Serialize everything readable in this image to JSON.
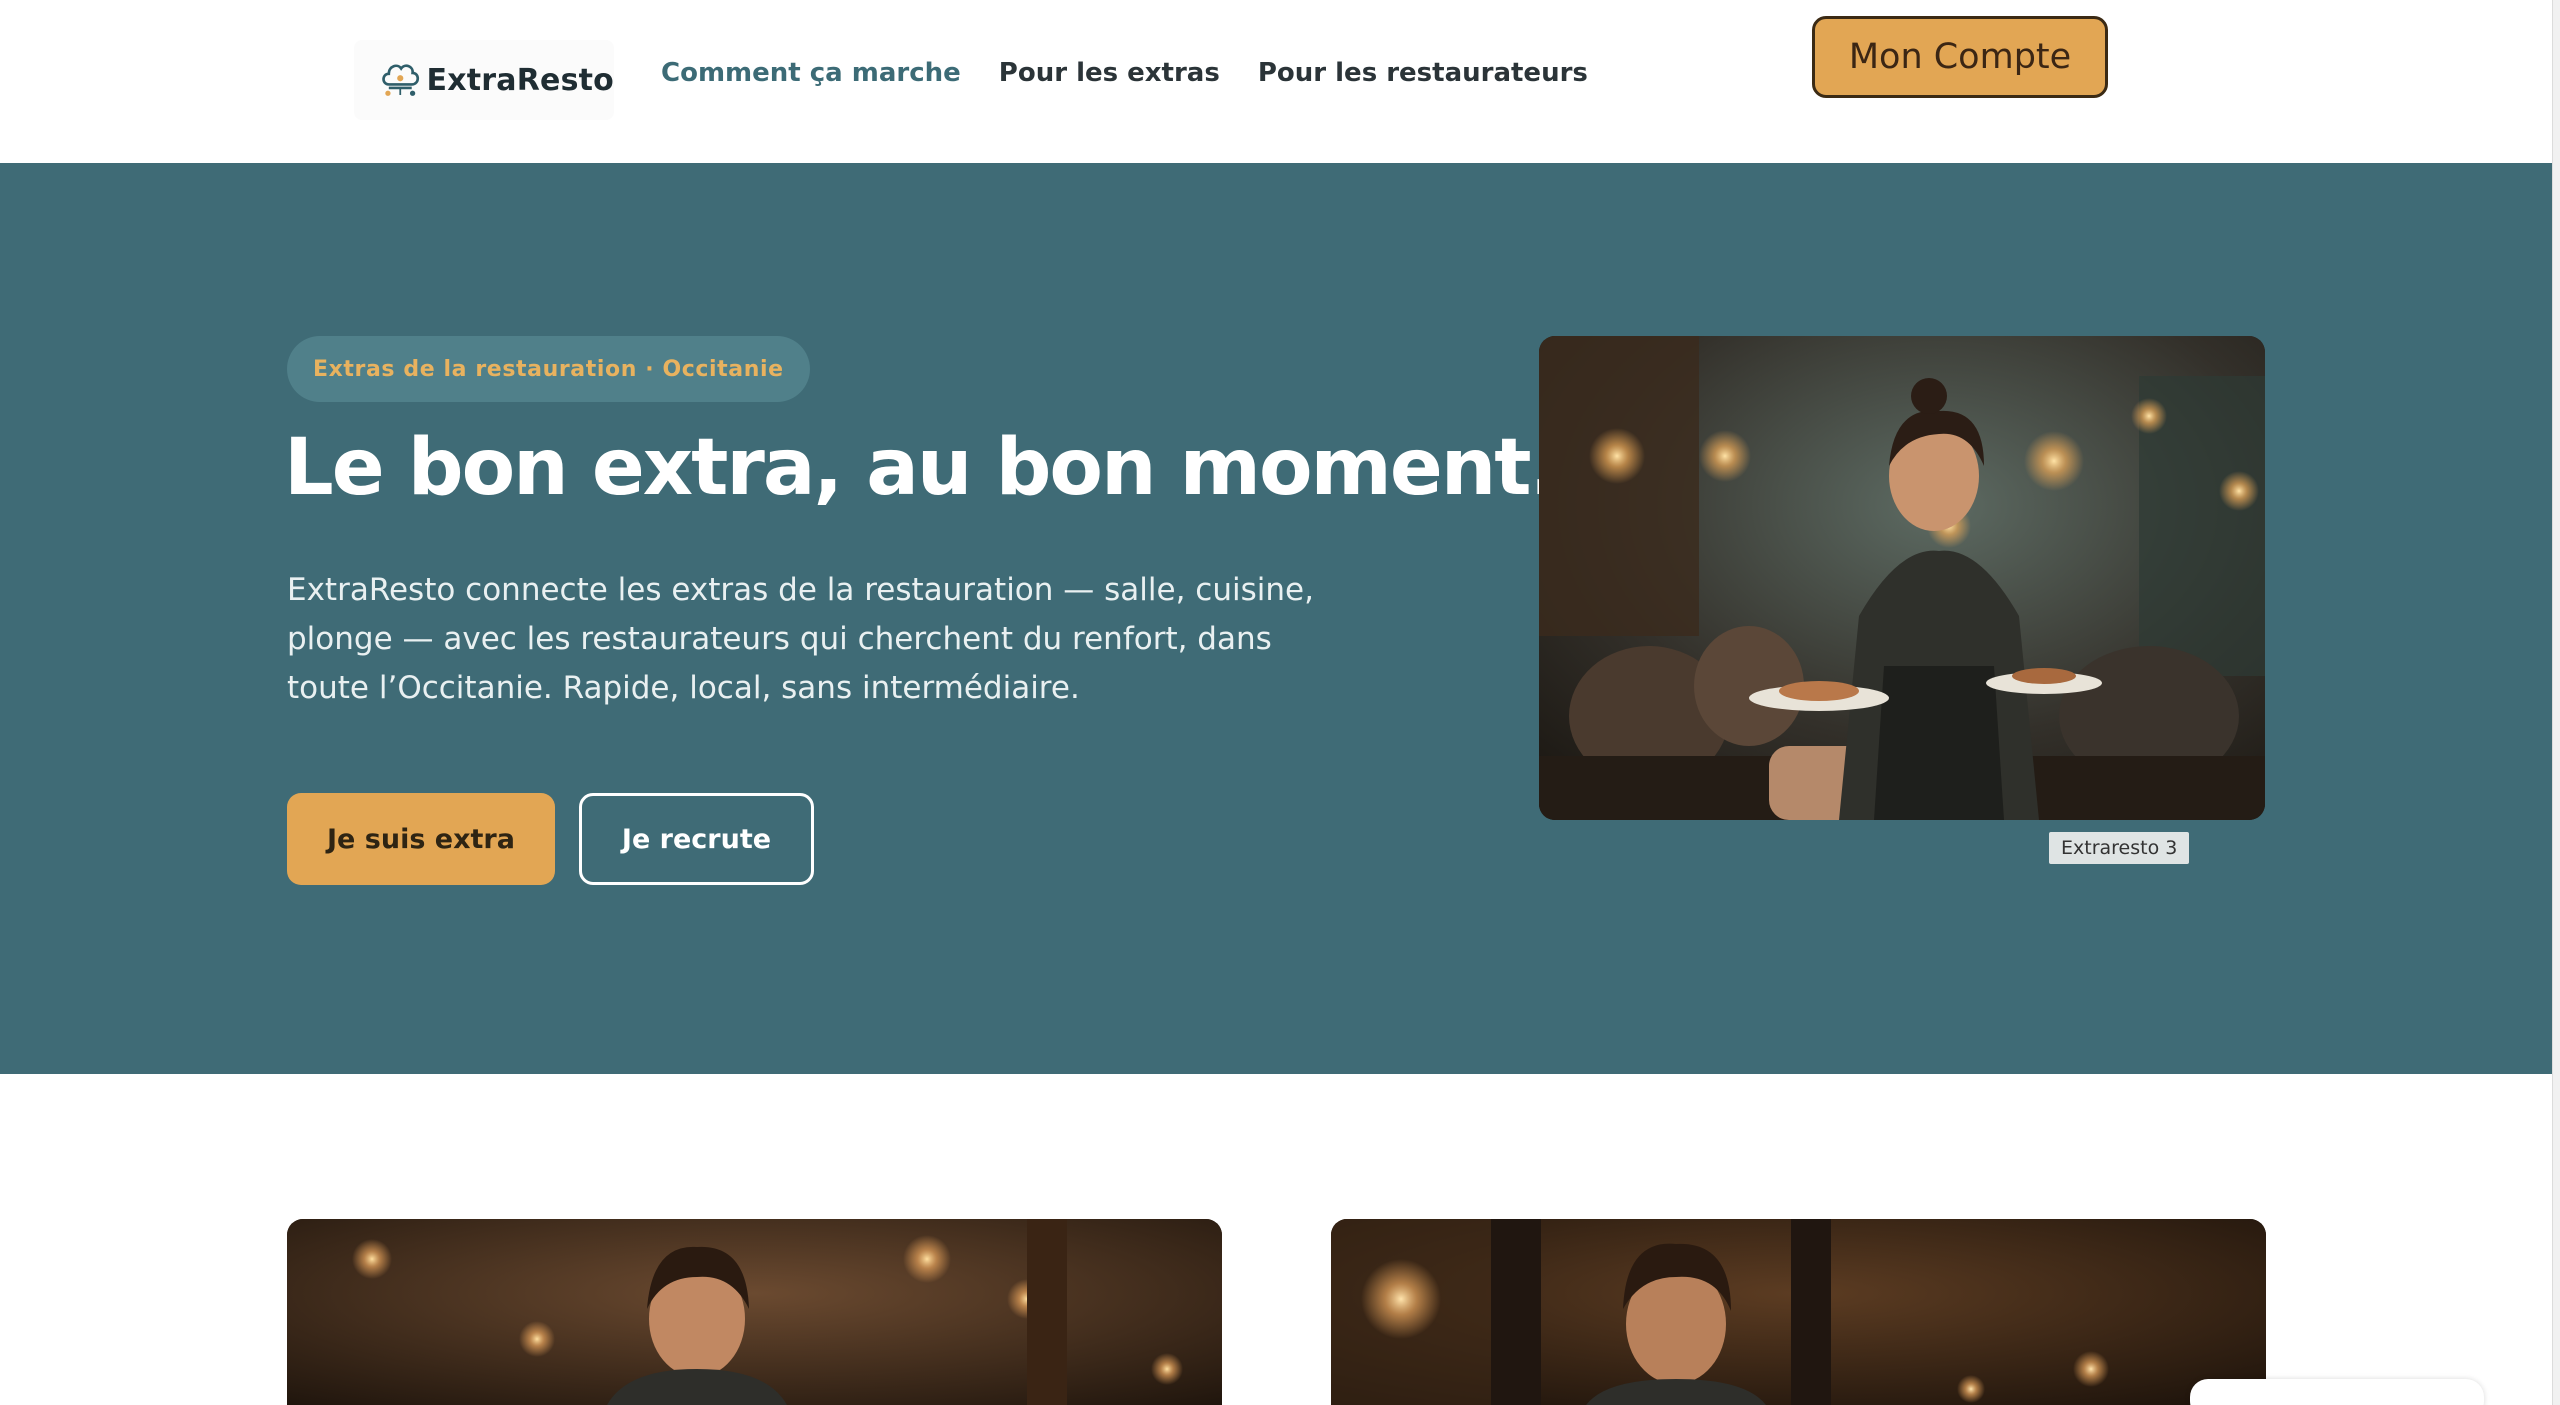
{
  "header": {
    "logo_text": "ExtraResto",
    "nav": [
      {
        "label": "Comment ça marche"
      },
      {
        "label": "Pour les extras"
      },
      {
        "label": "Pour les restaurateurs"
      }
    ],
    "account_button": "Mon Compte"
  },
  "hero": {
    "badge": "Extras de la restauration · Occitanie",
    "title": "Le bon extra, au bon moment.",
    "description": "ExtraResto connecte les extras de la restauration — salle, cuisine, plonge — avec les restaurateurs qui cherchent du renfort, dans toute l’Occitanie. Rapide, local, sans intermédiaire.",
    "primary_button": "Je suis extra",
    "secondary_button": "Je recrute",
    "photo_caption": "Extraresto 3"
  },
  "colors": {
    "hero_background": "#3f6b76",
    "accent": "#e2a654",
    "nav_active": "#3c6b76"
  },
  "icons": {
    "logo": "chef-hat-icon"
  }
}
